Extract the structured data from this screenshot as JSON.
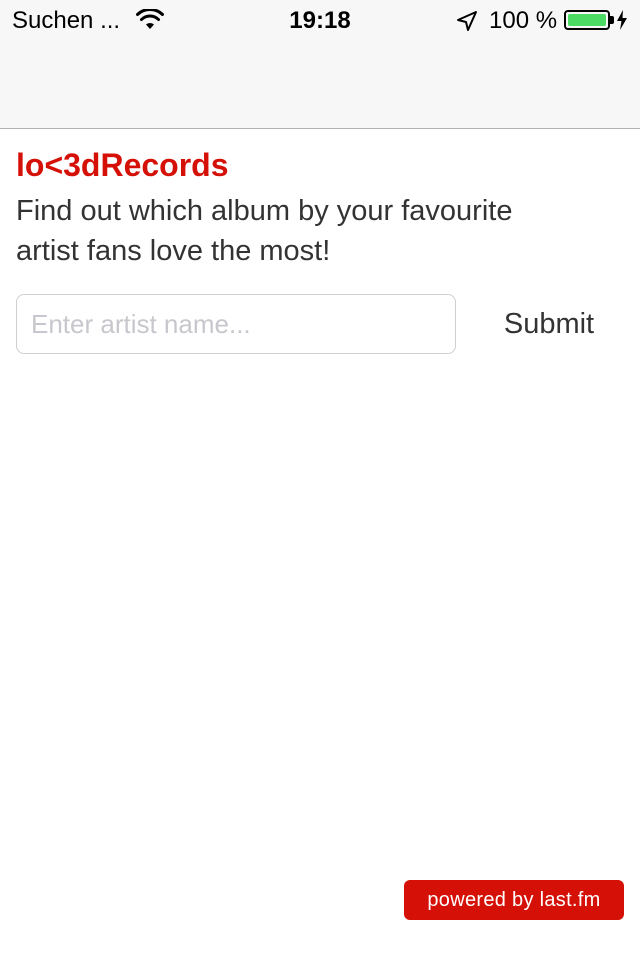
{
  "status_bar": {
    "carrier": "Suchen ...",
    "time": "19:18",
    "battery_percent": "100 %",
    "battery_level": 1.0,
    "icons": [
      "wifi-icon",
      "location-arrow-icon",
      "battery-icon",
      "charging-bolt-icon"
    ],
    "battery_color": "#4cd964"
  },
  "header": {
    "title": "lo<3dRecords",
    "tagline": "Find out which album by your favourite artist fans love the most!"
  },
  "search": {
    "placeholder": "Enter artist name...",
    "value": "",
    "submit_label": "Submit"
  },
  "footer": {
    "badge": "powered by last.fm"
  },
  "colors": {
    "accent": "#d51007",
    "text": "#333333",
    "placeholder": "#c7c7cd"
  }
}
